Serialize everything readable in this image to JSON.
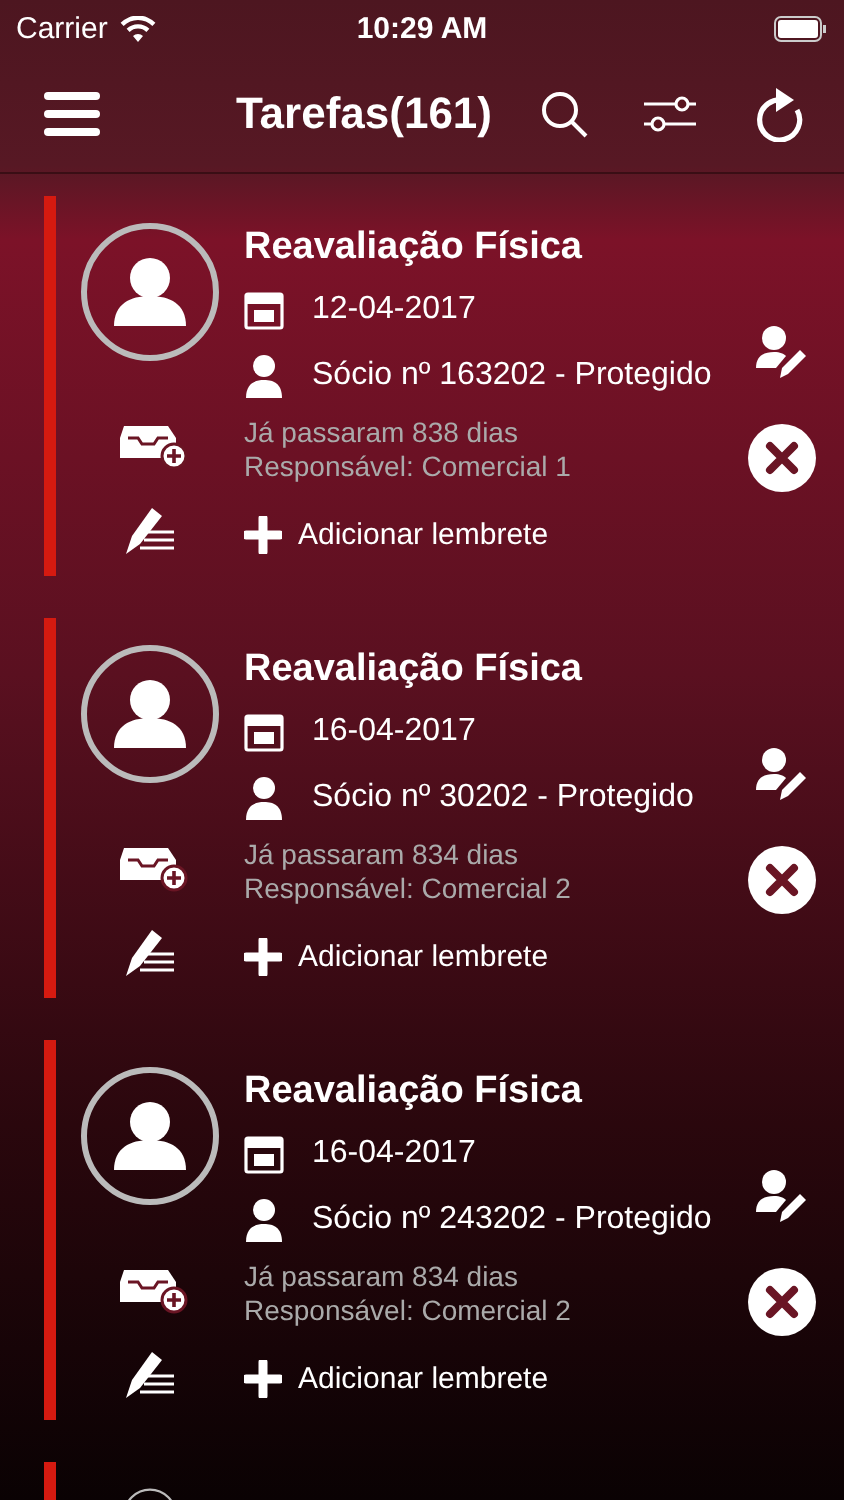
{
  "status_bar": {
    "carrier": "Carrier",
    "time": "10:29 AM"
  },
  "nav": {
    "title": "Tarefas(161)"
  },
  "tasks": [
    {
      "title": "Reavaliação Física",
      "date": "12-04-2017",
      "member": "Sócio nº 163202 - Protegido",
      "elapsed": "Já passaram 838 dias",
      "responsible": "Responsável: Comercial 1",
      "add_reminder": "Adicionar lembrete"
    },
    {
      "title": "Reavaliação Física",
      "date": "16-04-2017",
      "member": "Sócio nº 30202 - Protegido",
      "elapsed": "Já passaram 834 dias",
      "responsible": "Responsável: Comercial 2",
      "add_reminder": "Adicionar lembrete"
    },
    {
      "title": "Reavaliação Física",
      "date": "16-04-2017",
      "member": "Sócio nº 243202 - Protegido",
      "elapsed": "Já passaram 834 dias",
      "responsible": "Responsável: Comercial 2",
      "add_reminder": "Adicionar lembrete"
    }
  ]
}
